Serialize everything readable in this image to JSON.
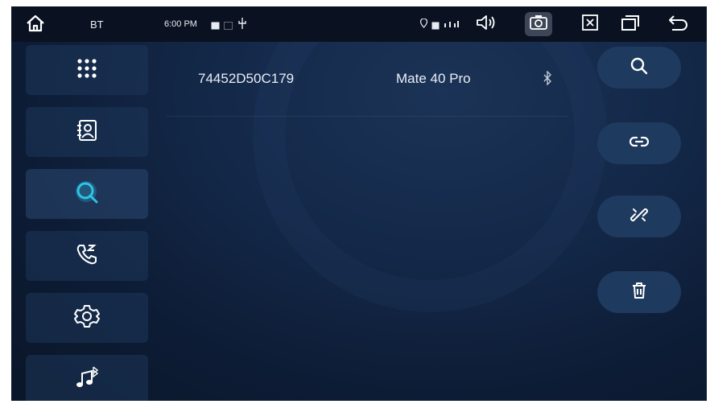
{
  "status_bar": {
    "app_label": "BT",
    "time": "6:00 PM",
    "icons": [
      "home-icon",
      "gallery-icon",
      "sd-card-icon",
      "usb-icon",
      "location-icon",
      "sim-icon",
      "signal-icon",
      "volume-icon",
      "camera-icon",
      "close-window-icon",
      "recent-apps-icon",
      "back-icon"
    ]
  },
  "sidebar": {
    "items": [
      {
        "name": "dialpad",
        "icon": "dialpad-icon"
      },
      {
        "name": "contacts",
        "icon": "contacts-icon"
      },
      {
        "name": "search-devices",
        "icon": "search-icon",
        "active": true
      },
      {
        "name": "call-log",
        "icon": "call-log-icon"
      },
      {
        "name": "settings",
        "icon": "gear-icon"
      },
      {
        "name": "bt-music",
        "icon": "bluetooth-music-icon"
      }
    ]
  },
  "devices": [
    {
      "address": "74452D50C179",
      "name": "Mate 40 Pro",
      "icon": "bluetooth-icon"
    }
  ],
  "actions": [
    {
      "name": "search",
      "icon": "search-icon"
    },
    {
      "name": "connect",
      "icon": "link-icon"
    },
    {
      "name": "disconnect",
      "icon": "unlink-icon"
    },
    {
      "name": "delete",
      "icon": "trash-icon"
    }
  ],
  "colors": {
    "background": "#14294a",
    "accent": "#2ec4e6",
    "button": "#1e3a5e",
    "statusbar": "#0a1222"
  }
}
